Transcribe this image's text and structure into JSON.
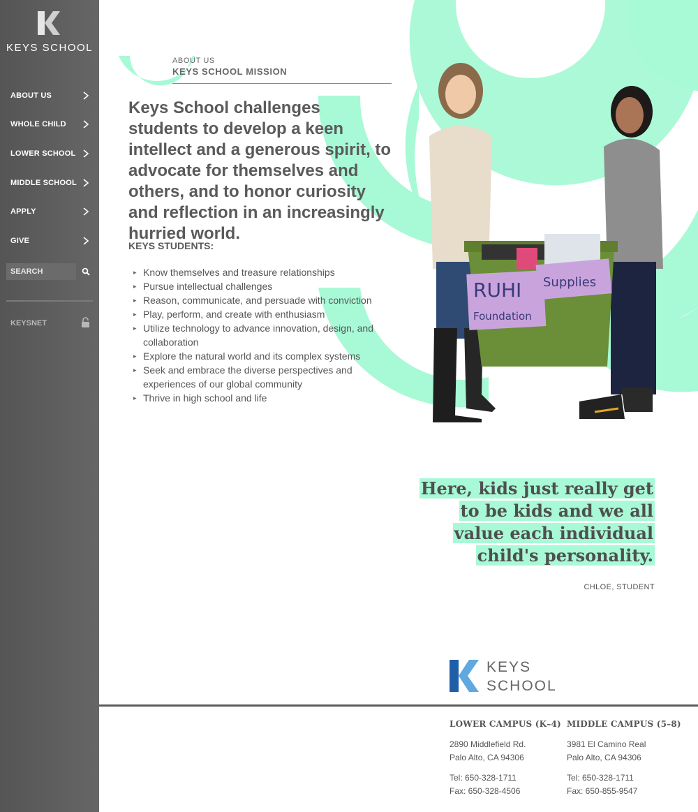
{
  "sidebar": {
    "logo_text": "KEYS SCHOOL",
    "nav": [
      {
        "label": "ABOUT US"
      },
      {
        "label": "WHOLE CHILD"
      },
      {
        "label": "LOWER SCHOOL"
      },
      {
        "label": "MIDDLE SCHOOL"
      },
      {
        "label": "APPLY"
      },
      {
        "label": "GIVE"
      }
    ],
    "search_placeholder": "SEARCH",
    "keysnet_label": "KEYSNET"
  },
  "header": {
    "breadcrumb": "ABOUT US",
    "section_title": "KEYS SCHOOL MISSION"
  },
  "main": {
    "mission": "Keys School challenges students to develop a keen intellect and a generous spirit, to advocate for themselves and others, and to honor curiosity and reflection in an increasingly hurried world.",
    "students_heading": "KEYS STUDENTS:",
    "students_list": [
      "Know themselves and treasure relationships",
      "Pursue intellectual challenges",
      "Reason, communicate, and persuade with conviction",
      "Play, perform, and create with enthusiasm",
      "Utilize technology to advance innovation, design, and collaboration",
      "Explore the natural world and its complex systems",
      "Seek and embrace the diverse perspectives and experiences of our global community",
      "Thrive in high school and life"
    ],
    "photo_sign_1": "RUHI",
    "photo_sign_2": "Foundation",
    "photo_sign_3": "Supplies"
  },
  "quote": {
    "text": "Here, kids just really get to be kids and we all value each individual child's personality.",
    "author": "CHLOE, STUDENT"
  },
  "footer": {
    "logo_line1": "KEYS",
    "logo_line2": "SCHOOL",
    "lower": {
      "title": "LOWER CAMPUS (K–4)",
      "address1": "2890 Middlefield Rd.",
      "address2": "Palo Alto, CA 94306",
      "tel": "Tel: 650-328-1711",
      "fax": "Fax: 650-328-4506"
    },
    "middle": {
      "title": "MIDDLE CAMPUS (5–8)",
      "address1": "3981 El Camino Real",
      "address2": "Palo Alto, CA 94306",
      "tel": "Tel: 650-328-1711",
      "fax": "Fax: 650-855-9547"
    }
  },
  "colors": {
    "accent_mint": "#a8f9d6",
    "sidebar_gray": "#5f5f5f",
    "logo_blue": "#1f5fa8",
    "logo_light_blue": "#5fa8e0"
  }
}
